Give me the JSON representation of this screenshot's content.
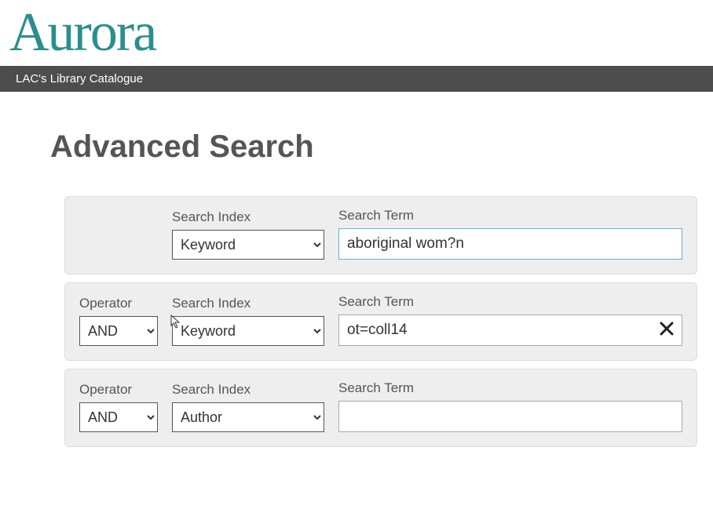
{
  "logo": {
    "text": "Aurora"
  },
  "navbar": {
    "title": "LAC's Library Catalogue"
  },
  "page": {
    "title": "Advanced Search"
  },
  "labels": {
    "operator": "Operator",
    "search_index": "Search Index",
    "search_term": "Search Term"
  },
  "rows": [
    {
      "has_operator": false,
      "operator": "",
      "index": "Keyword",
      "term": "aboriginal wom?n",
      "focused": true,
      "show_clear": false
    },
    {
      "has_operator": true,
      "operator": "AND",
      "index": "Keyword",
      "term": "ot=coll14",
      "focused": false,
      "show_clear": true
    },
    {
      "has_operator": true,
      "operator": "AND",
      "index": "Author",
      "term": "",
      "focused": false,
      "show_clear": false
    }
  ]
}
